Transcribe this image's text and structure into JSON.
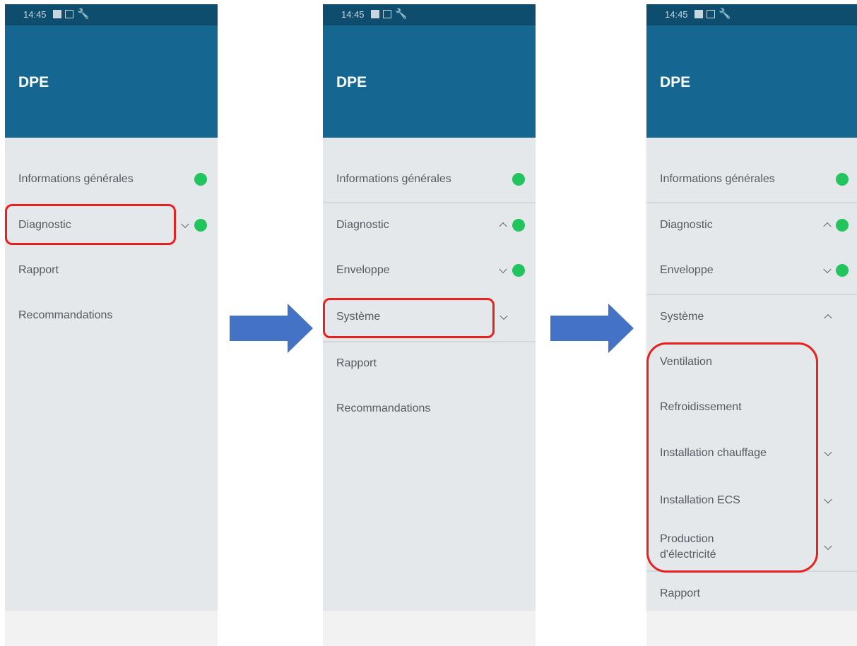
{
  "status_bar": {
    "time": "14:45"
  },
  "app": {
    "title": "DPE"
  },
  "screen1": {
    "items": [
      {
        "label": "Informations générales"
      },
      {
        "label": "Diagnostic"
      },
      {
        "label": "Rapport"
      },
      {
        "label": "Recommandations"
      }
    ]
  },
  "screen2": {
    "items": [
      {
        "label": "Informations générales"
      },
      {
        "label": "Diagnostic"
      },
      {
        "label": "Enveloppe"
      },
      {
        "label": "Système"
      },
      {
        "label": "Rapport"
      },
      {
        "label": "Recommandations"
      }
    ]
  },
  "screen3": {
    "items": [
      {
        "label": "Informations générales"
      },
      {
        "label": "Diagnostic"
      },
      {
        "label": "Enveloppe"
      },
      {
        "label": "Système"
      },
      {
        "label": "Ventilation"
      },
      {
        "label": "Refroidissement"
      },
      {
        "label": "Installation chauffage"
      },
      {
        "label": "Installation ECS"
      },
      {
        "label": "Production\nd'électricité"
      },
      {
        "label": "Rapport"
      }
    ]
  },
  "colors": {
    "app_bar": "#156690",
    "status_bar": "#0e4d6e",
    "status_dot": "#22c45e",
    "highlight": "#e8201e",
    "flow_arrow": "#4472c4"
  },
  "icons": [
    "image-icon",
    "cast-icon",
    "wrench-icon",
    "chevron-down-icon",
    "chevron-up-icon",
    "status-dot-icon",
    "flow-arrow-icon"
  ]
}
